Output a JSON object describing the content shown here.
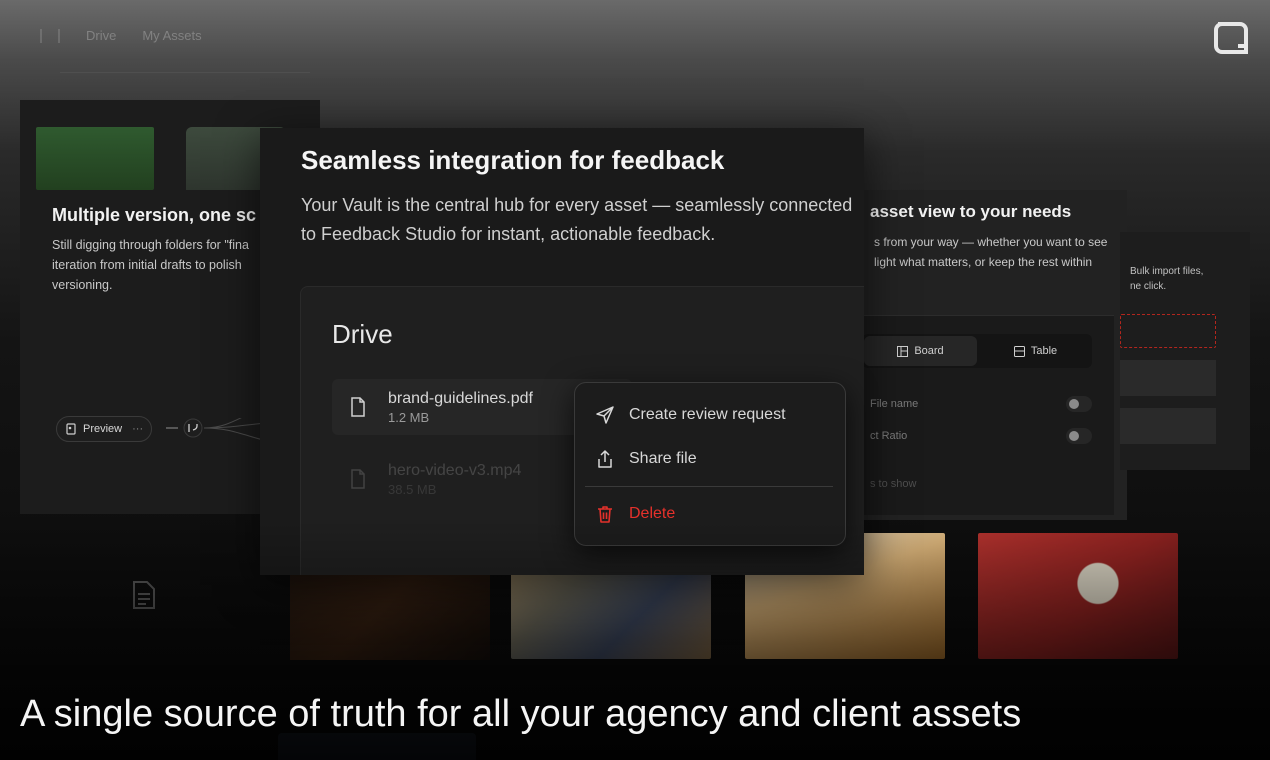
{
  "topnav": {
    "tab_drive": "Drive",
    "tab_my_assets": "My Assets"
  },
  "card_left": {
    "title": "Multiple version, one sc",
    "body_line1": "Still digging through folders for \"fina",
    "body_line2": "iteration from initial drafts to polish",
    "body_line3": "versioning.",
    "preview_label": "Preview",
    "more_label": "···"
  },
  "main_card": {
    "title": "Seamless integration for feedback",
    "description": "Your Vault is the central hub for every asset — seamlessly connected to Feedback Studio for instant, actionable feedback.",
    "drive": {
      "heading": "Drive",
      "files": [
        {
          "name": "brand-guidelines.pdf",
          "size": "1.2 MB"
        },
        {
          "name": "hero-video-v3.mp4",
          "size": "38.5 MB"
        }
      ]
    },
    "context_menu": {
      "create_review": "Create review request",
      "share": "Share file",
      "delete": "Delete"
    }
  },
  "card_right": {
    "title": "asset view to your needs",
    "body_line1": "s from your way — whether you want to see",
    "body_line2": "light what matters, or keep the rest within",
    "view_board": "Board",
    "view_table": "Table",
    "opt_file_name": "File name",
    "opt_aspect_ratio": "ct Ratio",
    "faded_text": "s to show"
  },
  "card_far": {
    "line1": "Bulk import files,",
    "line2": "ne click."
  },
  "headline": "A single source of truth for all your agency and client assets",
  "colors": {
    "danger": "#e5312b",
    "background": "#070707",
    "card": "#1a1a1a"
  }
}
